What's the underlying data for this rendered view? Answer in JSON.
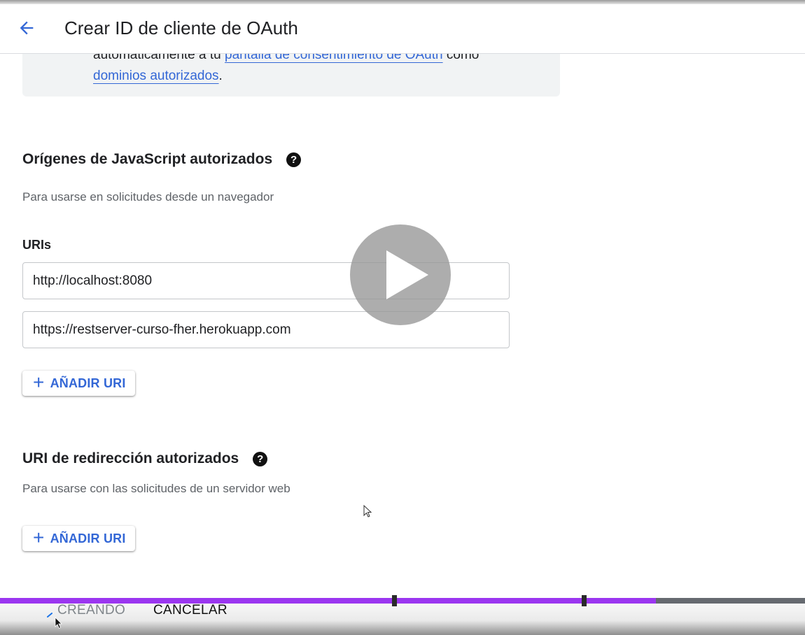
{
  "header": {
    "title": "Crear ID de cliente de OAuth",
    "back_icon": "arrow-back-icon"
  },
  "info": {
    "line1_prefix": "automáticamente a tu ",
    "line1_link": "pantalla de consentimiento de OAuth",
    "line1_suffix": " como",
    "line2_link": "dominios autorizados",
    "line2_suffix": "."
  },
  "js_origins": {
    "title": "Orígenes de JavaScript autorizados",
    "help_icon": "help-circle-icon",
    "help_glyph": "?",
    "description": "Para usarse en solicitudes desde un navegador",
    "uris_label": "URIs",
    "uris": [
      "http://localhost:8080",
      "https://restserver-curso-fher.herokuapp.com"
    ],
    "add_label": "AÑADIR URI"
  },
  "redirect": {
    "title": "URI de redirección autorizados",
    "help_icon": "help-circle-icon",
    "help_glyph": "?",
    "description": "Para usarse con las solicitudes de un servidor web",
    "add_label": "AÑADIR URI"
  },
  "actions": {
    "creating_label": "CREANDO",
    "cancel_label": "CANCELAR"
  },
  "video": {
    "play_icon": "play-icon",
    "progress_fraction": 0.815
  },
  "colors": {
    "accent": "#3367d6",
    "progress": "#9b36f0",
    "help_icon": "#111111"
  }
}
